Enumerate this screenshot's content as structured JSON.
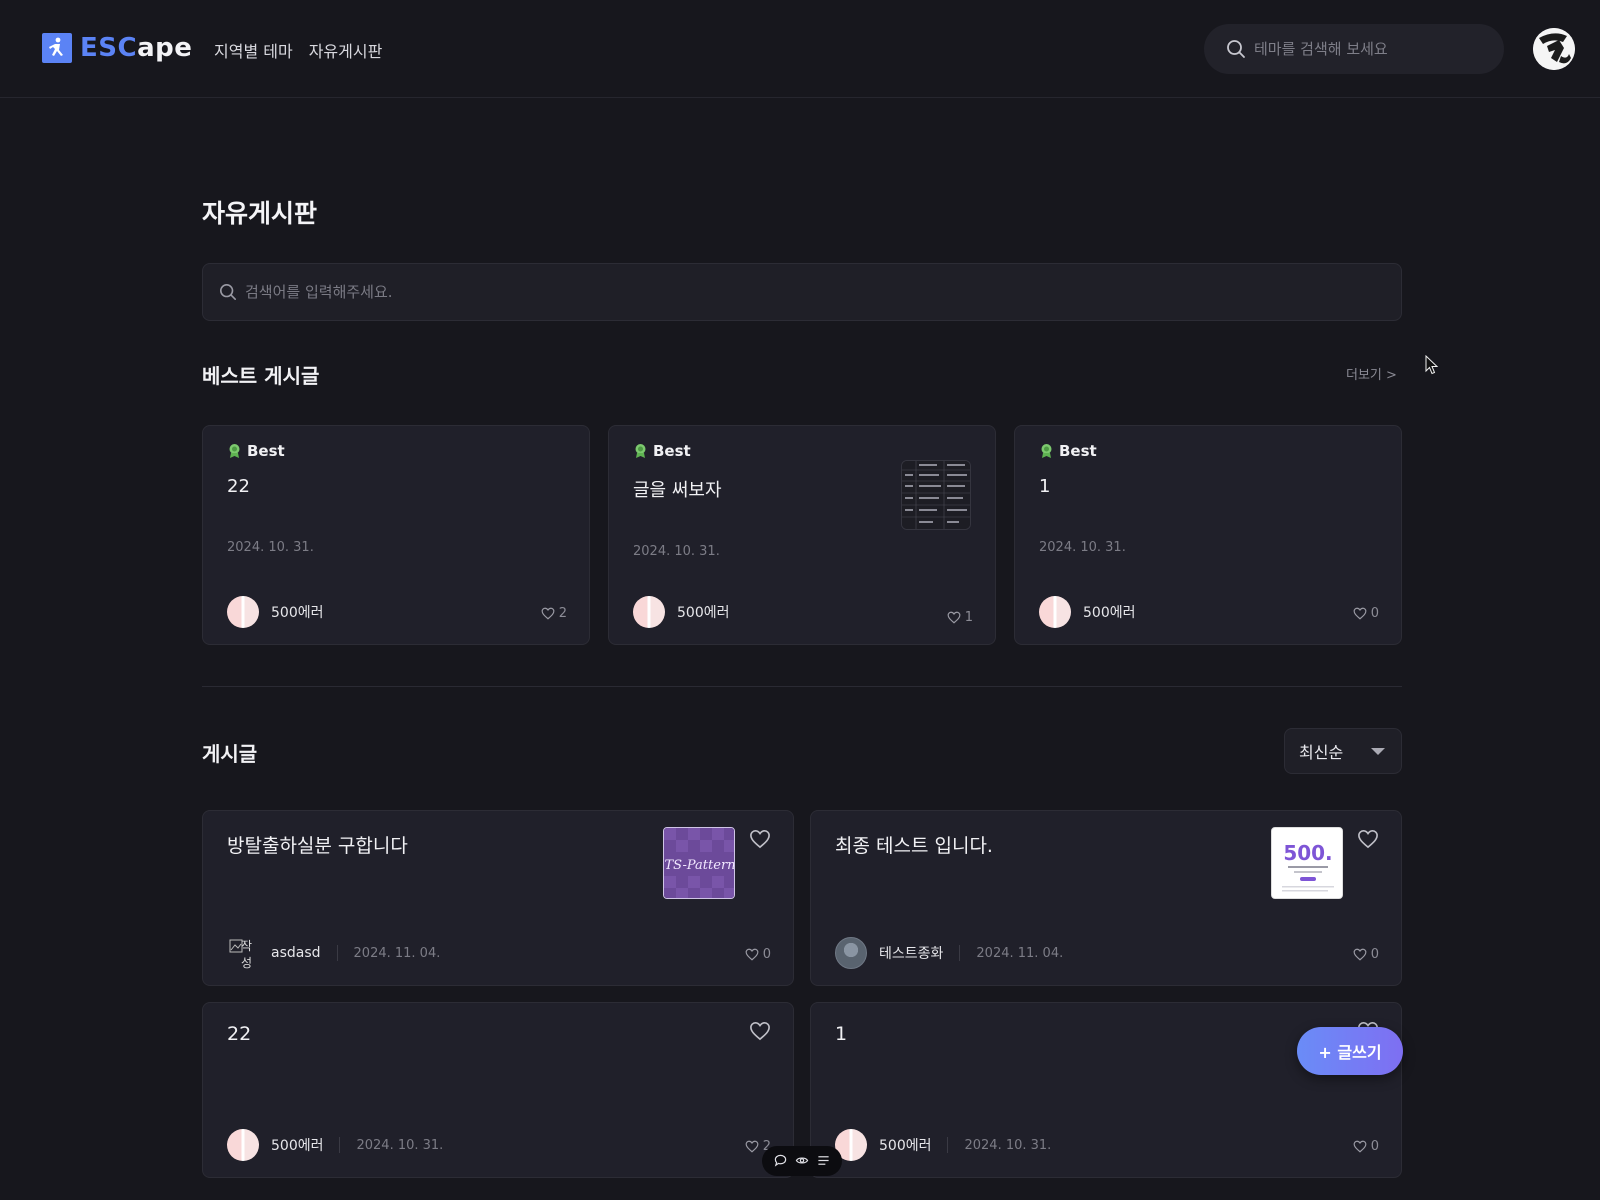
{
  "header": {
    "logo_prefix": "ESC",
    "logo_suffix": "ape",
    "nav": [
      "지역별 테마",
      "자유게시판"
    ],
    "search_placeholder": "테마를 검색해 보세요"
  },
  "board": {
    "title": "자유게시판",
    "search_placeholder": "검색어를 입력해주세요."
  },
  "best": {
    "section_title": "베스트 게시글",
    "more_label": "더보기 >",
    "badge_label": "Best",
    "cards": [
      {
        "title": "22",
        "date": "2024. 10. 31.",
        "author": "500에러",
        "likes": "2"
      },
      {
        "title": "글을 써보자",
        "date": "2024. 10. 31.",
        "author": "500에러",
        "likes": "1"
      },
      {
        "title": "1",
        "date": "2024. 10. 31.",
        "author": "500에러",
        "likes": "0"
      }
    ]
  },
  "posts": {
    "section_title": "게시글",
    "sort_label": "최신순",
    "items": [
      {
        "title": "방탈출하실분 구합니다",
        "author": "asdasd",
        "date": "2024. 11. 04.",
        "likes": "0",
        "thumb_text": "TS-Pattern",
        "avatar_alt": "작성"
      },
      {
        "title": "최종 테스트 입니다.",
        "author": "테스트종화",
        "date": "2024. 11. 04.",
        "likes": "0",
        "thumb_text": "500."
      },
      {
        "title": "22",
        "author": "500에러",
        "date": "2024. 10. 31.",
        "likes": "2"
      },
      {
        "title": "1",
        "author": "500에러",
        "date": "2024. 10. 31.",
        "likes": "0"
      }
    ]
  },
  "write_button_label": "+ 글쓰기",
  "colors": {
    "background": "#17171d",
    "card": "#20202a",
    "accent": "#5b83f5"
  },
  "icons": [
    "search-icon",
    "heart-icon",
    "award-icon",
    "chevron-down-icon",
    "comment-icon",
    "eye-icon",
    "list-icon"
  ]
}
